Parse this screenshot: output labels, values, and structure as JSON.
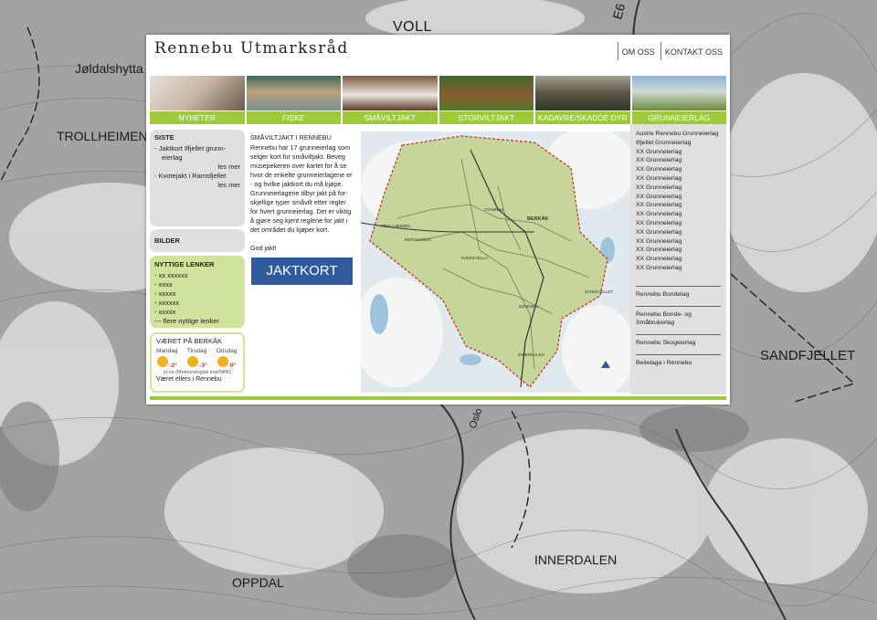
{
  "background_labels": [
    "VOLL",
    "Jøldalshytta",
    "TROLLHEIMEN",
    "SANDFJELLET",
    "INNERDALEN",
    "OPPDAL",
    "Oslo",
    "E6"
  ],
  "header": {
    "logo_text": "Rennebu Utmarksråd",
    "links": [
      "OM OSS",
      "KONTAKT OSS"
    ]
  },
  "photos": [
    "photo-1",
    "photo-fish",
    "photo-grouse",
    "photo-deer",
    "photo-moose",
    "photo-landscape"
  ],
  "nav": [
    "NYHETER",
    "FISKE",
    "SMÅVILTJAKT",
    "STORVILTJAKT",
    "KADAVRE/SKADDE DYR",
    "GRUNNEIERLAG"
  ],
  "left": {
    "siste_title": "SISTE",
    "siste_items": [
      {
        "text": "- Jaktkort Ilfjellet grunn-",
        "text2": "eierlag",
        "more": "les mer"
      },
      {
        "text": "- Kvotejakt i Ramsfjellet",
        "text2": "",
        "more": "les mer"
      }
    ],
    "bilder": "BILDER",
    "nyttige_title": "NYTTIGE LENKER",
    "nyttige_items": [
      "- xx xxxxxx",
      "- xxxx",
      "- xxxxx",
      "- xxxxxx",
      "- xxxxx",
      "--- flere nyttige lenker"
    ],
    "weather_title": "VÆRET PÅ BERKÅK",
    "days": [
      {
        "day": "Mandag",
        "temp": "-2°"
      },
      {
        "day": "Tirsdag",
        "temp": "-3°"
      },
      {
        "day": "Onsdag",
        "temp": "0°"
      }
    ],
    "source": "yr.no (Meteorologisk inst/NRK)",
    "elsewhere": "Været ellers i Rennebu"
  },
  "middle": {
    "title": "SMÅVILTJAKT I RENNEBU",
    "body": "Rennebu har 17 grunneierlag som selger kort for småviltjakt. Beveg musepekeren over kartet for å se hvor de enkelte grunneierlagene er - og hvilke jaktkort du må kjøpe. Grunneierlagene tilbyr jakt på for-skjellige typer småvilt etter regler for hvert grunneierlag. Det er viktig å gjøre seg kjent reglene for jakt i det området du kjøper kort.",
    "god_jakt": "God jakt!",
    "button": "JAKTKORT"
  },
  "map_labels": [
    "TROLLHEIMEN",
    "BERKÅK",
    "RAMSFJELLA",
    "INNERDALEN",
    "SANDFJELLET",
    "BJORSEN",
    "NERSKOGEN",
    "STAMNAN"
  ],
  "right": {
    "lag": [
      "Austre Rennebu Grunneierlag",
      "Ilfjellet Grunneierlag",
      "XX Grunneierlag",
      "XX Grunneierlag",
      "XX Grunneierlag",
      "XX Grunneierlag",
      "XX Grunneierlag",
      "XX Grunneierlag",
      "XX Grunneierlag",
      "XX Grunneierlag",
      "XX Grunneierlag",
      "XX Grunneierlag",
      "XX Grunneierlag",
      "XX Grunneierlag",
      "XX Grunneierlag",
      "XX Grunneierlag"
    ],
    "sections": [
      "Rennebu Bondelag",
      "Rennebu Bonde- og Småbrukerlag",
      "Rennebu Skogeierlag",
      "Beitelaga i Rennebu"
    ]
  },
  "colors": {
    "accent_green": "#9dc93a",
    "button_blue": "#2f5b9e",
    "map_border": "#d0242b"
  }
}
